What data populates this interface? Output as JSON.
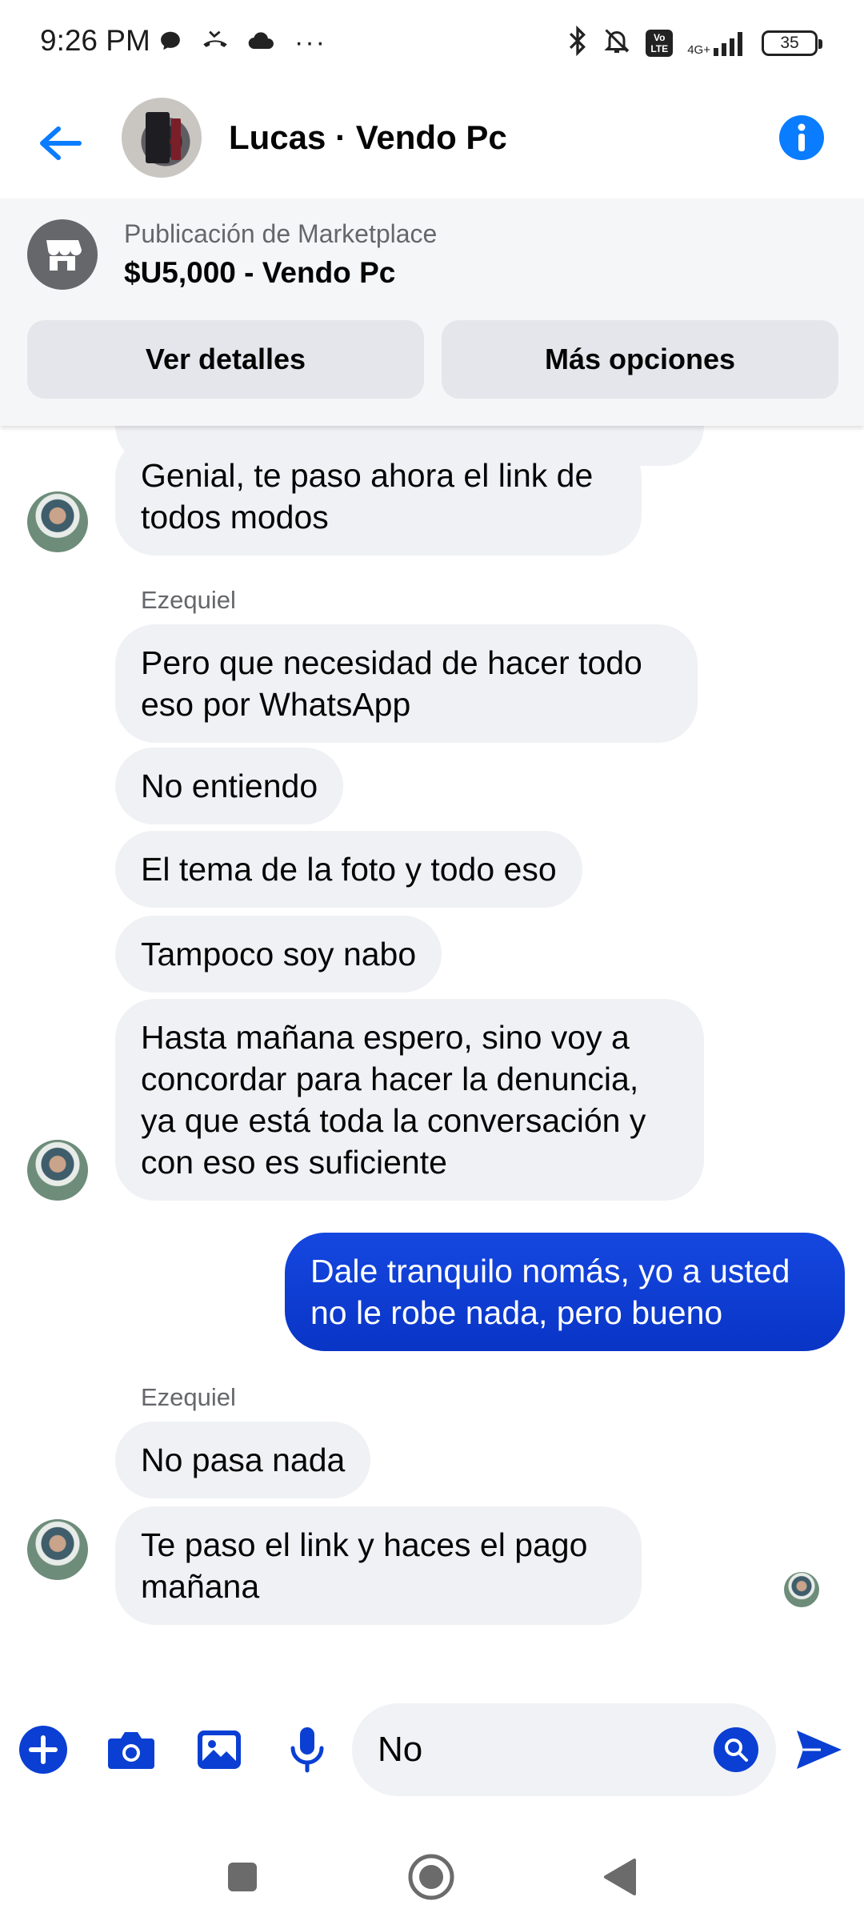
{
  "status_bar": {
    "time": "9:26 PM",
    "more_dots": "···",
    "network_type": "4G+",
    "volte": "Vo LTE",
    "battery": "35"
  },
  "header": {
    "contact_name": "Lucas · Vendo Pc"
  },
  "marketplace": {
    "subtitle": "Publicación de Marketplace",
    "listing": "$U5,000 - Vendo Pc",
    "details_button": "Ver detalles",
    "options_button": "Más opciones"
  },
  "conversation": {
    "sender_name": "Ezequiel",
    "messages": [
      {
        "direction": "in",
        "text": "Genial, te paso ahora el link de todos modos"
      },
      {
        "direction": "in",
        "text": "Pero que necesidad de hacer todo eso por WhatsApp"
      },
      {
        "direction": "in",
        "text": "No entiendo"
      },
      {
        "direction": "in",
        "text": "El tema de la foto y todo eso"
      },
      {
        "direction": "in",
        "text": "Tampoco soy nabo"
      },
      {
        "direction": "in",
        "text": "Hasta mañana espero, sino voy a concordar para hacer la denuncia, ya que está toda la conversación y con eso es suficiente"
      },
      {
        "direction": "out",
        "text": "Dale tranquilo nomás, yo a usted no le robe nada, pero bueno"
      },
      {
        "direction": "in",
        "text": "No pasa nada"
      },
      {
        "direction": "in",
        "text": "Te paso el link y haces el pago mañana"
      }
    ]
  },
  "composer": {
    "input_value": "No"
  },
  "colors": {
    "accent": "#0a7cff",
    "outgoing_bubble": "#0b3fd3",
    "incoming_bubble": "#f0f1f4",
    "composer_icons": "#0b3fd3"
  }
}
